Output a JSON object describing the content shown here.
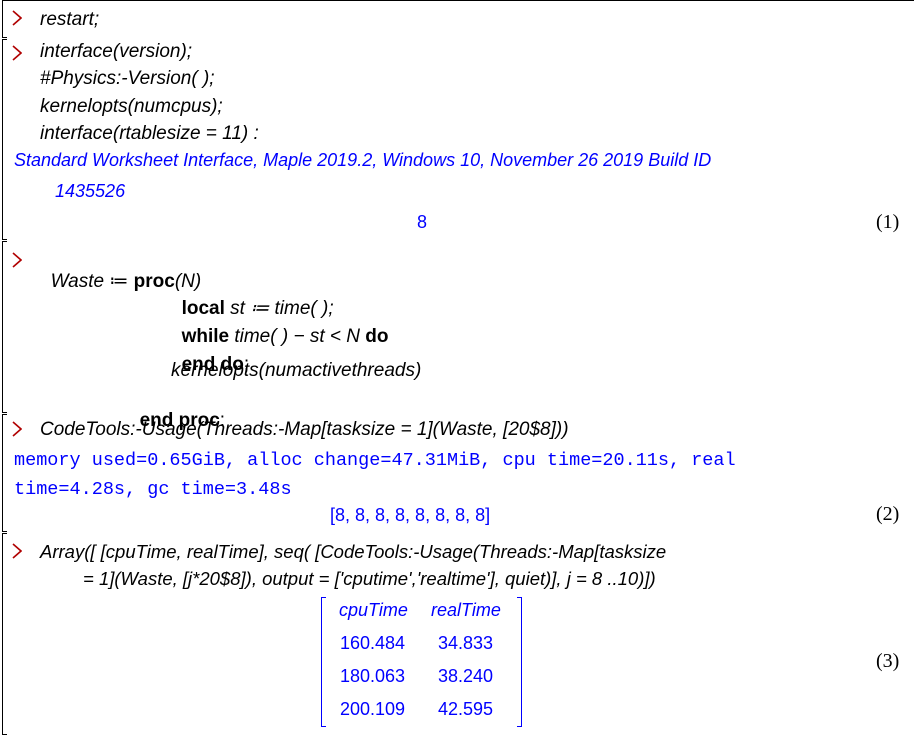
{
  "block1": {
    "line1": "restart;"
  },
  "block2": {
    "line1": "interface(version);",
    "line2": "#Physics:-Version( );",
    "line3": "kernelopts(numcpus);",
    "line4_a": "interface(rtablesize = 11) :",
    "output_line1": "Standard Worksheet Interface, Maple 2019.2, Windows 10, November 26 2019 Build ID",
    "output_line2": "1435526",
    "output_value": "8",
    "eq_label": "(1)"
  },
  "block3": {
    "l1_name": "Waste",
    "l1_assign": " ≔ ",
    "l1_proc": "proc",
    "l1_arg": "(N)",
    "l2_local": "local",
    "l2_rest": " st ≔ time( );",
    "l3_while": "while",
    "l3_mid": " time( ) − st < N ",
    "l3_do": "do",
    "l4_end": "end do",
    "l4_semi": ";",
    "l5": "kernelopts(numactivethreads)",
    "l6_end": "end proc",
    "l6_colon": ":"
  },
  "block4": {
    "input": "CodeTools:-Usage(Threads:-Map[tasksize = 1](Waste, [20$8]))",
    "mem_line1": "memory used=0.65GiB, alloc change=47.31MiB, cpu time=20.11s, real",
    "mem_line2": "time=4.28s, gc time=3.48s",
    "result": "[8, 8, 8, 8, 8, 8, 8, 8]",
    "eq_label": "(2)"
  },
  "block5": {
    "input_line1": "Array([ [cpuTime, realTime], seq( [CodeTools:-Usage(Threads:-Map[tasksize",
    "input_line2": "= 1](Waste, [j*20$8]), output = ['cputime','realtime'], quiet)], j = 8 ..10)])",
    "matrix": {
      "headers": [
        "cpuTime",
        "realTime"
      ],
      "rows": [
        [
          "160.484",
          "34.833"
        ],
        [
          "180.063",
          "38.240"
        ],
        [
          "200.109",
          "42.595"
        ]
      ]
    },
    "eq_label": "(3)"
  }
}
